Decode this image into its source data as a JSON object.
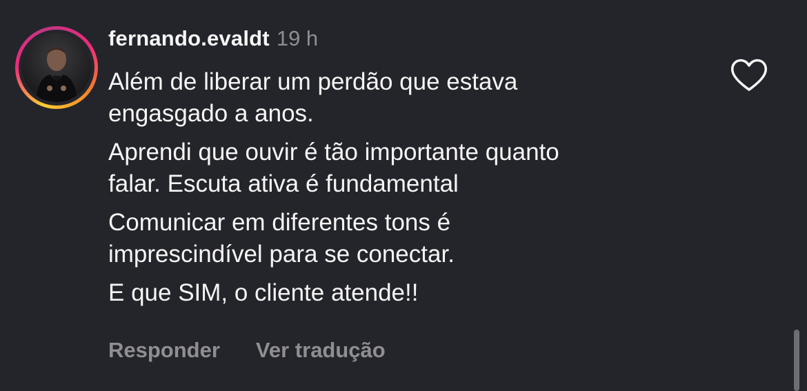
{
  "comment": {
    "username": "fernando.evaldt",
    "time": "19 h",
    "paragraphs": [
      "Além de liberar um perdão que estava\nengasgado a anos.",
      "Aprendi que ouvir é tão importante quanto\nfalar. Escuta ativa é fundamental",
      "Comunicar em diferentes tons é\nimprescindível para se conectar.",
      "E que SIM, o cliente atende!!"
    ],
    "reply_label": "Responder",
    "translate_label": "Ver tradução"
  },
  "icons": {
    "like": "heart-outline-icon",
    "avatar_ring": "story-ring"
  },
  "colors": {
    "background": "#24252a",
    "text": "#f5f5f5",
    "muted": "#8e8e93",
    "ring_gradient": [
      "#f9ce34",
      "#ee2a7b",
      "#c13584",
      "#f58529"
    ]
  }
}
